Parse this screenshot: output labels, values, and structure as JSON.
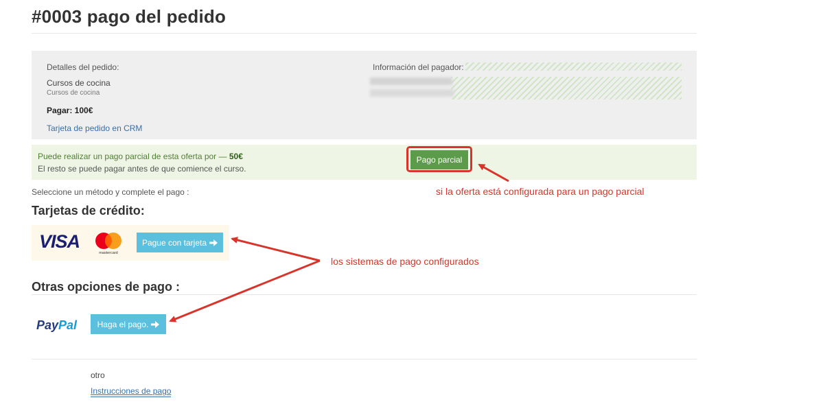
{
  "page": {
    "title": "#0003 pago del pedido"
  },
  "order": {
    "details_label": "Detalles del pedido:",
    "course_name": "Cursos de cocina",
    "course_subtitle": "Cursos de cocina",
    "pay_label": "Pagar: 100€",
    "crm_link": "Tarjeta de pedido en CRM"
  },
  "payer": {
    "label": "Información del pagador:"
  },
  "partial": {
    "line1_prefix": "Puede realizar un pago parcial de esta oferta por — ",
    "amount": "50€",
    "line2": "El resto se puede pagar antes de que comience el curso.",
    "button_label": "Pago parcial"
  },
  "select_method": "Seleccione un método y complete el pago :",
  "credit_cards": {
    "heading": "Tarjetas de crédito:",
    "visa_logo": "VISA",
    "mastercard_logo": "mastercard",
    "button_label": "Pague con tarjeta"
  },
  "other_options": {
    "heading": "Otras opciones de pago :",
    "paypal_logo_pay": "Pay",
    "paypal_logo_pal": "Pal",
    "button_label": "Haga el pago."
  },
  "other": {
    "label": "otro",
    "link": "Instrucciones de pago"
  },
  "annotations": {
    "partial_note": "si la oferta está configurada para un pago parcial",
    "systems_note": "los sistemas de pago configurados"
  },
  "colors": {
    "annotation_red": "#d9342b",
    "partial_green": "#5c9b4a",
    "pay_blue": "#5bc0de",
    "visa_navy": "#1a1f71",
    "paypal_dark": "#253b80",
    "paypal_light": "#179bd7"
  },
  "icons": {
    "arrow_right": "arrow-right-icon"
  }
}
